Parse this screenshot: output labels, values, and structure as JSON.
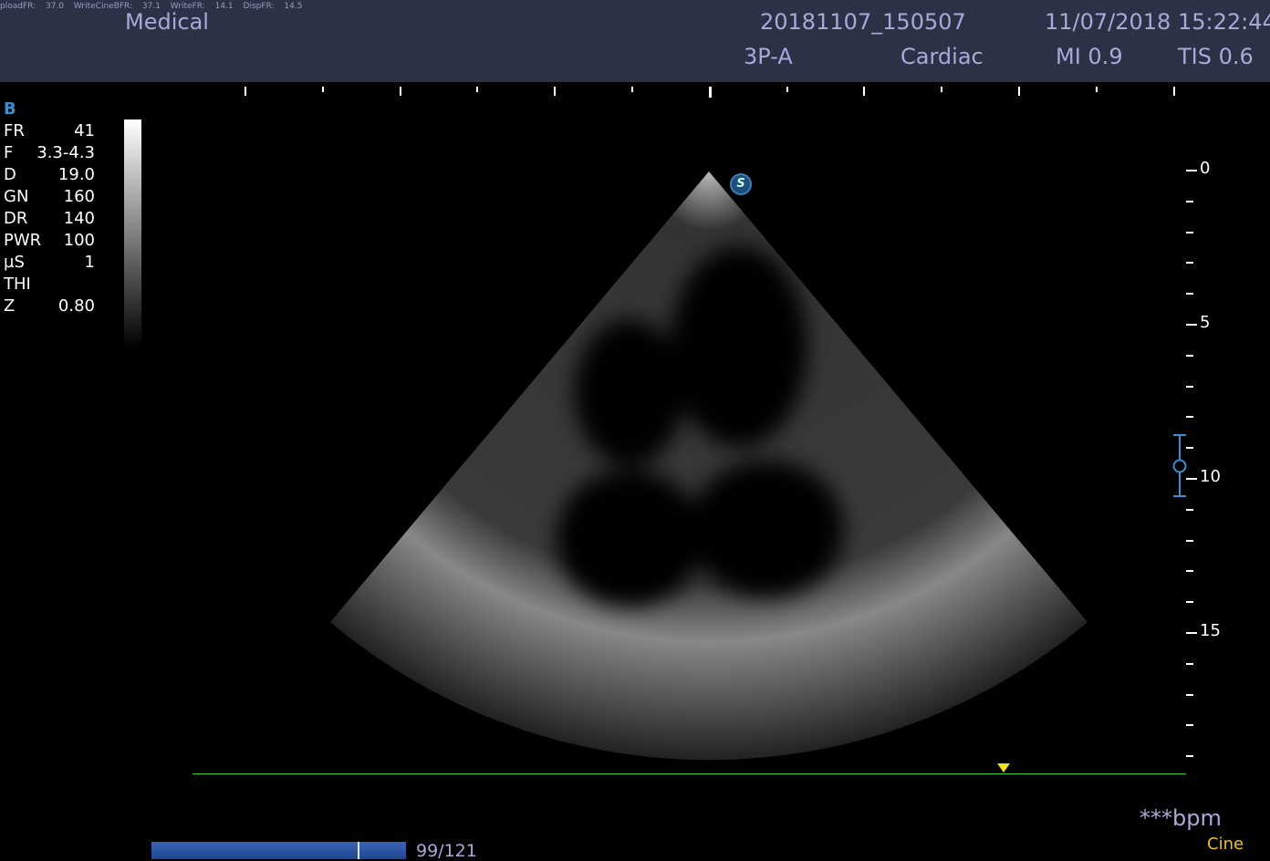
{
  "header": {
    "diagnostics": "ploadFR: 37.0   WriteCineBFR: 37.1   WriteFR: 14.1   DispFR: 14.5",
    "institution": "Medical",
    "study_id": "20181107_150507",
    "datetime": "11/07/2018 15:22:44",
    "probe": "3P-A",
    "preset": "Cardiac",
    "mi": "MI 0.9",
    "tis": "TIS 0.6"
  },
  "mode": "B",
  "params": [
    [
      "FR",
      "41"
    ],
    [
      "F",
      "3.3-4.3"
    ],
    [
      "D",
      "19.0"
    ],
    [
      "GN",
      "160"
    ],
    [
      "DR",
      "140"
    ],
    [
      "PWR",
      "100"
    ],
    [
      "µS",
      "1"
    ],
    [
      "THI",
      ""
    ],
    [
      "Z",
      "0.80"
    ]
  ],
  "depth_labels": [
    "0",
    "5",
    "10",
    "15"
  ],
  "focus_depth_cm": 10,
  "steer_icon": "S",
  "heart_rate": "***bpm",
  "cine": {
    "label": "Cine",
    "current": 99,
    "total": 121,
    "text": "99/121"
  },
  "colors": {
    "header": "#2c3246",
    "accent": "#3b8fd0",
    "ecg": "#3ad13a",
    "cine": "#f0c020"
  }
}
